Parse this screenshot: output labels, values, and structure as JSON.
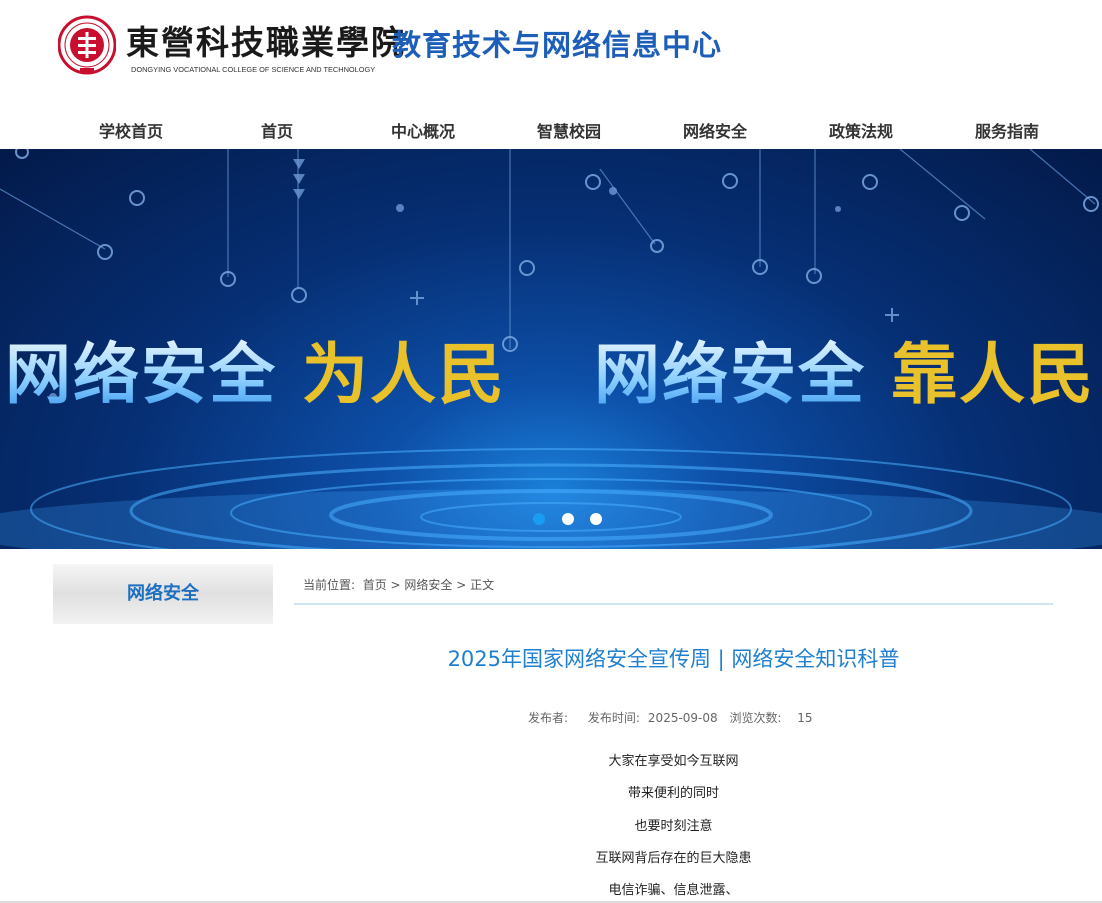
{
  "header": {
    "school_name": "東營科技職業學院",
    "school_name_en": "DONGYING VOCATIONAL COLLEGE OF SCIENCE AND TECHNOLOGY",
    "center_name": "教育技术与网络信息中心",
    "brand_color": "#1d5fb8",
    "seal_color": "#c8102e"
  },
  "nav": {
    "items": [
      {
        "label": "学校首页"
      },
      {
        "label": "首页"
      },
      {
        "label": "中心概况"
      },
      {
        "label": "智慧校园"
      },
      {
        "label": "网络安全"
      },
      {
        "label": "政策法规"
      },
      {
        "label": "服务指南"
      }
    ]
  },
  "banner": {
    "slogan_left_white": "网络安全",
    "slogan_left_yellow": "为人民",
    "slogan_right_white": "网络安全",
    "slogan_right_yellow": "靠人民",
    "slide_count": 3,
    "active_slide": 1
  },
  "sidebar": {
    "title": "网络安全"
  },
  "breadcrumb": {
    "prefix": "当前位置:",
    "items": [
      "首页",
      "网络安全",
      "正文"
    ],
    "separator": ">"
  },
  "article": {
    "title": "2025年国家网络安全宣传周 | 网络安全知识科普",
    "publisher_label": "发布者:",
    "publisher": "",
    "time_label": "发布时间:",
    "time": "2025-09-08",
    "views_label": "浏览次数:",
    "views": "15",
    "paragraphs": [
      "大家在享受如今互联网",
      "带来便利的同时",
      "也要时刻注意",
      "互联网背后存在的巨大隐患",
      "电信诈骗、信息泄露、"
    ]
  }
}
